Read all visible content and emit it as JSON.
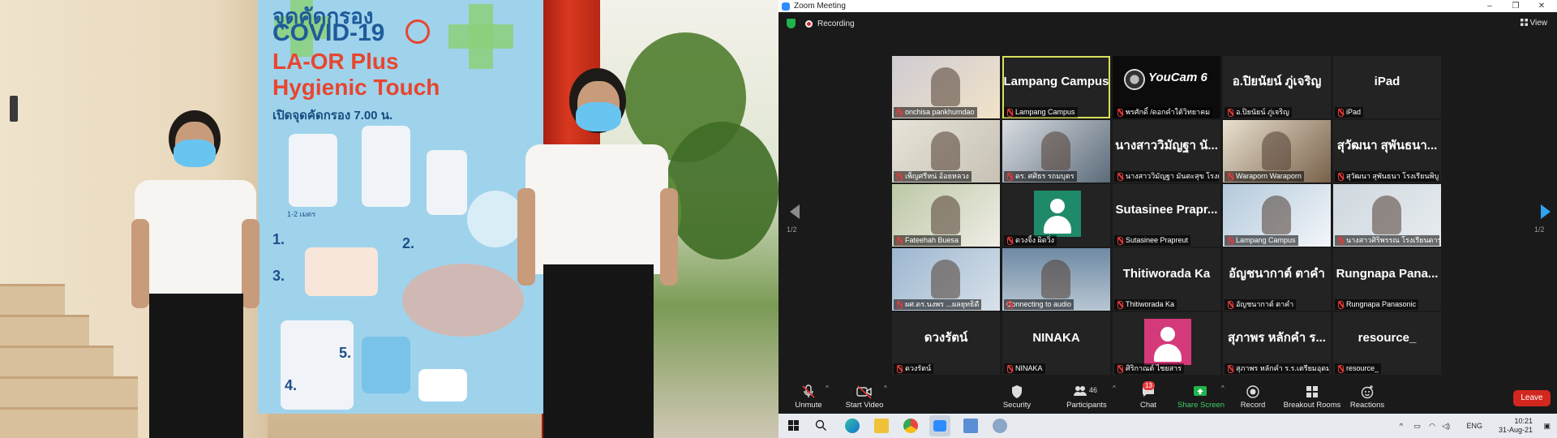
{
  "banner": {
    "line1": "จุดคัดกรอง",
    "line2": "COVID-19",
    "line3": "LA-OR Plus",
    "line4": "Hygienic Touch",
    "line5": "เปิดจุดคัดกรอง 7.00 น.",
    "step_numbers": [
      "1.",
      "2.",
      "3.",
      "4.",
      "5."
    ],
    "step_hint": "1-2 เมตร"
  },
  "zoom": {
    "window_title": "Zoom Meeting",
    "recording_label": "Recording",
    "view_label": "View",
    "page_indicator_left": "1/2",
    "page_indicator_right": "1/2",
    "tiles": [
      {
        "name": "onchisa pankhumdao",
        "type": "video"
      },
      {
        "name": "Lampang Campus",
        "big": "Lampang Campus",
        "active": true
      },
      {
        "name": "พรศักดิ์ /ดอกคำใต้วิทยาคม",
        "type": "youcam",
        "logo": "YouCam 6"
      },
      {
        "name": "อ.ปิยนัยน์ ภู่เจริญ",
        "big": "อ.ปิยนัยน์ ภู่เจริญ"
      },
      {
        "name": "iPad",
        "big": "iPad"
      },
      {
        "name": "เพ็ญศรีหน่ อ้อยหลวง",
        "type": "video"
      },
      {
        "name": "ดร. ศศิธร รถมบุตร",
        "type": "video"
      },
      {
        "name": "นางสาววิมัญฐา มันตะสุข โรงเรี...",
        "big": "นางสาววิมัญฐา นั..."
      },
      {
        "name": "Waraporn Waraporn",
        "type": "video"
      },
      {
        "name": "สุวัฒนา สุพันธนา โรงเรียนพิบู...",
        "big": "สุวัฒนา สุพันธนา..."
      },
      {
        "name": "Fateehah  Buesa",
        "type": "video"
      },
      {
        "name": "ดวงจิ้ง ผิดวิ่ง",
        "type": "avatar",
        "avatar_bg": "#1f8a6a"
      },
      {
        "name": "Sutasinee Prapreut",
        "big": "Sutasinee  Prapr..."
      },
      {
        "name": "Lampang Campus",
        "type": "video"
      },
      {
        "name": "นางสาวศิริพรรณ  โรงเรียนดาร...",
        "type": "video"
      },
      {
        "name": "ผศ.ดร.นงพร ...ผลยุทธิดี",
        "type": "video"
      },
      {
        "name": "Connecting to audio",
        "type": "video",
        "connecting": true
      },
      {
        "name": "Thitiworada Ka",
        "big": "Thitiworada Ka"
      },
      {
        "name": "อัญชนากาต์  ตาคำ",
        "big": "อัญชนากาต์  ตาคำ"
      },
      {
        "name": "Rungnapa Panasonic",
        "big": "Rungnapa  Pana..."
      },
      {
        "name": "ดวงรัตน์",
        "big": "ดวงรัตน์"
      },
      {
        "name": "NINAKA",
        "big": "NINAKA"
      },
      {
        "name": "ศิริกาณต์ ไชยสาร",
        "type": "avatar",
        "avatar_bg": "#d43a7a"
      },
      {
        "name": "สุภาพร หลักคำ ร.ร.เตรียมอุดม...",
        "big": "สุภาพร หลักคำ ร..."
      },
      {
        "name": "resource_",
        "big": "resource_"
      }
    ],
    "toolbar": {
      "unmute": "Unmute",
      "start_video": "Start Video",
      "security": "Security",
      "participants": "Participants",
      "participants_count": "46",
      "chat": "Chat",
      "chat_badge": "13",
      "share_screen": "Share Screen",
      "record": "Record",
      "breakout_rooms": "Breakout Rooms",
      "reactions": "Reactions",
      "leave": "Leave"
    }
  },
  "taskbar": {
    "lang": "ENG",
    "time": "10:21",
    "date": "31-Aug-21"
  },
  "colors": {
    "zoom_blue": "#2d8cff",
    "share_green": "#21b34c",
    "leave_red": "#d2271e",
    "active_speaker": "#d9e05a"
  }
}
